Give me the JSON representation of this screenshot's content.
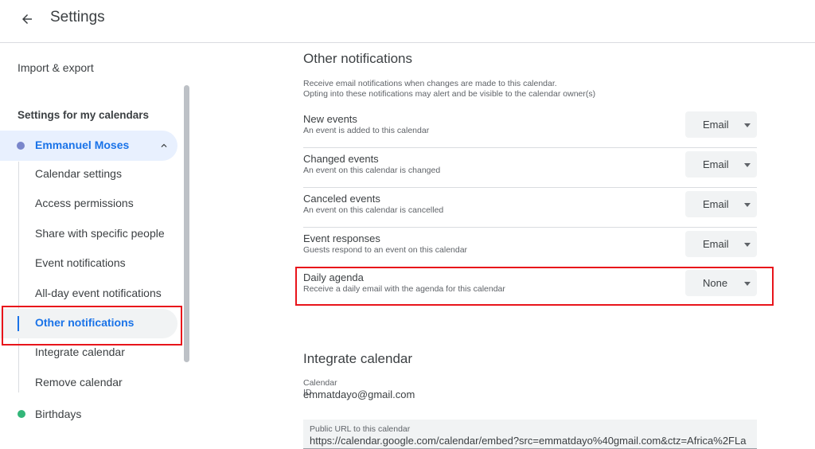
{
  "header": {
    "title": "Settings",
    "back_icon": "arrow-left-icon"
  },
  "sidebar": {
    "import_export": "Import & export",
    "section_label": "Settings for my calendars",
    "calendar_owner": {
      "label": "Emmanuel Moses",
      "color": "#7986cb",
      "expanded": true
    },
    "items": [
      {
        "label": "Calendar settings",
        "active": false
      },
      {
        "label": "Access permissions",
        "active": false
      },
      {
        "label": "Share with specific people",
        "active": false
      },
      {
        "label": "Event notifications",
        "active": false
      },
      {
        "label": "All-day event notifications",
        "active": false
      },
      {
        "label": "Other notifications",
        "active": true
      },
      {
        "label": "Integrate calendar",
        "active": false
      },
      {
        "label": "Remove calendar",
        "active": false
      }
    ],
    "birthdays": {
      "label": "Birthdays",
      "color": "#33b679"
    }
  },
  "other_notifications": {
    "title": "Other notifications",
    "description_line1": "Receive email notifications when changes are made to this calendar.",
    "description_line2": "Opting into these notifications may alert and be visible to the calendar owner(s)",
    "rows": [
      {
        "title": "New events",
        "subtitle": "An event is added to this calendar",
        "value": "Email"
      },
      {
        "title": "Changed events",
        "subtitle": "An event on this calendar is changed",
        "value": "Email"
      },
      {
        "title": "Canceled events",
        "subtitle": "An event on this calendar is cancelled",
        "value": "Email"
      },
      {
        "title": "Event responses",
        "subtitle": "Guests respond to an event on this calendar",
        "value": "Email"
      },
      {
        "title": "Daily agenda",
        "subtitle": "Receive a daily email with the agenda for this calendar",
        "value": "None"
      }
    ]
  },
  "integrate": {
    "title": "Integrate calendar",
    "calendar_id_label": "Calendar ID",
    "calendar_id": "emmatdayo@gmail.com",
    "public_url_label": "Public URL to this calendar",
    "public_url": "https://calendar.google.com/calendar/embed?src=emmatdayo%40gmail.com&ctz=Africa%2FLa"
  },
  "colors": {
    "accent": "#1a73e8",
    "highlight": "#e8141b"
  }
}
